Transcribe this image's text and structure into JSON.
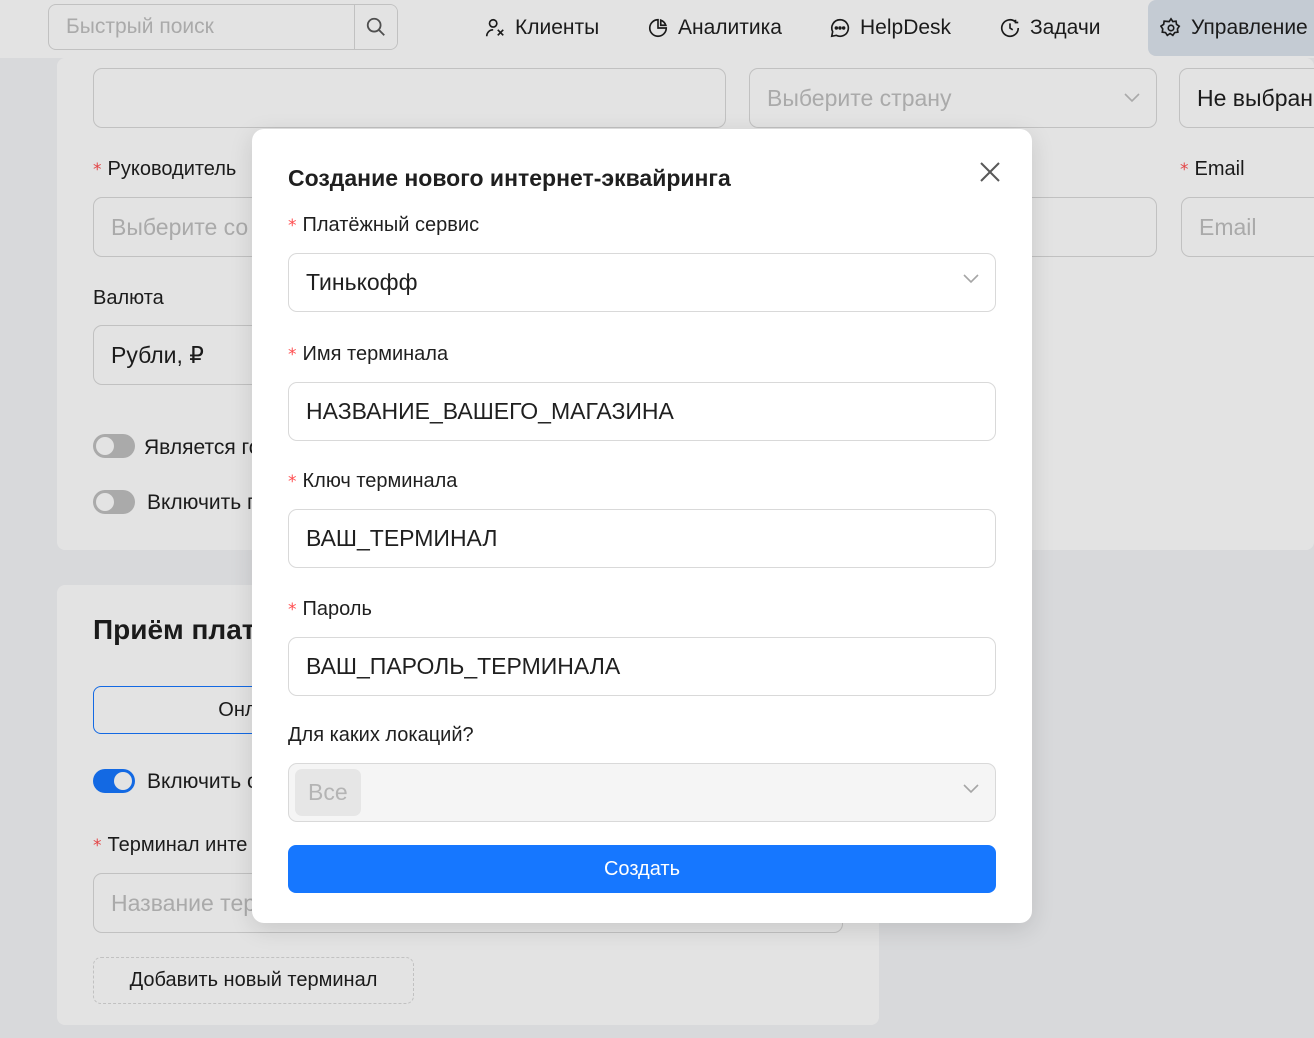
{
  "topbar": {
    "search_placeholder": "Быстрый поиск",
    "nav": [
      {
        "label": "Клиенты",
        "icon": "users-icon"
      },
      {
        "label": "Аналитика",
        "icon": "pie-chart-icon"
      },
      {
        "label": "HelpDesk",
        "icon": "chat-icon"
      },
      {
        "label": "Задачи",
        "icon": "clock-check-icon"
      },
      {
        "label": "Управление",
        "icon": "gear-icon",
        "active": true
      }
    ]
  },
  "background": {
    "country_placeholder": "Выберите страну",
    "not_selected": "Не выбран",
    "manager_label": "Руководитель",
    "manager_placeholder": "Выберите со",
    "email_label": "Email",
    "email_placeholder": "Email",
    "currency_label": "Валюта",
    "currency_value": "Рубли, ₽",
    "toggle1_label": "Является го",
    "toggle2_label": "Включить п",
    "payments_title": "Приём плат",
    "online_tab": "Онла",
    "toggle3_label": "Включить о",
    "terminal_label": "Терминал инте",
    "terminal_placeholder": "Название тер",
    "add_terminal": "Добавить новый терминал"
  },
  "modal": {
    "title": "Создание нового интернет-эквайринга",
    "service_label": "Платёжный сервис",
    "service_value": "Тинькофф",
    "terminal_name_label": "Имя терминала",
    "terminal_name_value": "НАЗВАНИЕ_ВАШЕГО_МАГАЗИНА",
    "terminal_key_label": "Ключ терминала",
    "terminal_key_value": "ВАШ_ТЕРМИНАЛ",
    "password_label": "Пароль",
    "password_value": "ВАШ_ПАРОЛЬ_ТЕРМИНАЛА",
    "locations_label": "Для каких локаций?",
    "locations_tag": "Все",
    "submit_label": "Создать",
    "required_mark": "*"
  },
  "colors": {
    "primary": "#1677ff",
    "required": "#ff4d4f",
    "border": "#d9d9d9"
  }
}
